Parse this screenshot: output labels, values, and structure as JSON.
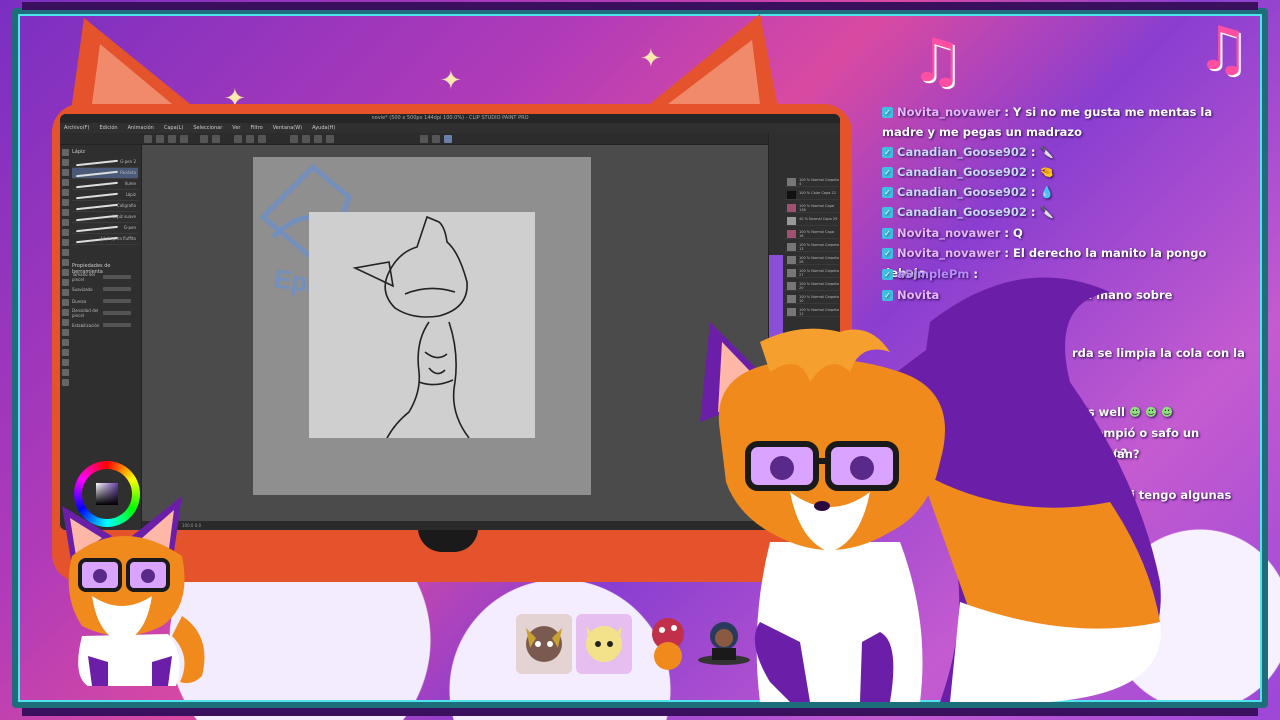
{
  "app": {
    "title": "novie* (500 x 500px 144dpi 100.0%) - CLIP STUDIO PAINT PRO",
    "menu": [
      "Archivo(F)",
      "Edición",
      "Animación",
      "Capa(L)",
      "Seleccionar",
      "Ver",
      "Filtro",
      "Ventana(W)",
      "Ayuda(H)"
    ],
    "brushes": {
      "panel_title": "Lápiz",
      "items": [
        "G-pen 2",
        "Realista",
        "llume",
        "Lápiz",
        "Caligrafía",
        "Lápiz suave",
        "G-pen",
        "Lápiz para fluffito"
      ]
    },
    "properties": {
      "title": "Propiedades de herramienta",
      "rows": [
        "Tamaño del pincel",
        "Suavizado",
        "Dureza",
        "Densidad del pincel",
        "Estabilización"
      ]
    },
    "layers": [
      "100 % Normal Carpeta 4",
      "100 % Color Capa 22",
      "100 % Normal Capa 138",
      "40 % Normal Capa 29",
      "100 % Normal Capa 16",
      "100 % Normal Carpeta 13",
      "100 % Normal Carpeta 26",
      "100 % Normal Carpeta 27",
      "100 % Normal Carpeta 20",
      "100 % Normal Carpeta 10",
      "100 % Normal Carpeta 11"
    ],
    "status": "100.0   0.0"
  },
  "canvas": {
    "watermark": "Epic Fluffy"
  },
  "chat": [
    {
      "user": "Novita_novawer",
      "sep": ":",
      "text": "Y si no me gusta me mentas la madre y me pegas un madrazo",
      "user_color": "novita"
    },
    {
      "user": "Canadian_Goose902",
      "sep": ":",
      "text": "🔪",
      "user_color": "canada"
    },
    {
      "user": "Canadian_Goose902",
      "sep": ":",
      "text": "🤏",
      "user_color": "canada"
    },
    {
      "user": "Canadian_Goose902",
      "sep": ":",
      "text": "💧",
      "user_color": "canada"
    },
    {
      "user": "Canadian_Goose902",
      "sep": ":",
      "text": "🔪",
      "user_color": "canada"
    },
    {
      "user": "Novita_novawer",
      "sep": ":",
      "text": "Q",
      "user_color": "novita"
    },
    {
      "user": "Novita_novawer",
      "sep": ":",
      "text": "El derecho la manito la pongo debajo",
      "user_color": "novita"
    },
    {
      "user": "aSimplePm",
      "sep": ":",
      "text": "",
      "user_color": "simple"
    },
    {
      "user": "Novita",
      "sep": "",
      "text": "abajo pero la mano sobre",
      "user_color": "novita"
    },
    {
      "user": "",
      "sep": "",
      "text": "rda se limpia la cola con la",
      "user_color": "novita"
    },
    {
      "user": "",
      "sep": "",
      "text": "ll is well",
      "user_color": "novita"
    },
    {
      "user": "",
      "sep": "",
      "text": "e rompió o safo un wesito?",
      "user_color": "novita"
    },
    {
      "user": "",
      "sep": "",
      "text": "g hacían?",
      "user_color": "novita"
    },
    {
      "user": "",
      "sep": "",
      "text": "si tengo algunas",
      "user_color": "novita"
    }
  ],
  "colors": {
    "monitor": "#e4532b",
    "frame": "#1d6e7a",
    "frame_glow": "#4fe3ee",
    "fox_orange": "#f08a1c",
    "fox_purple": "#6b1fa8"
  },
  "icons": [
    "check-icon",
    "music-note-icon",
    "sparkle-icon"
  ]
}
